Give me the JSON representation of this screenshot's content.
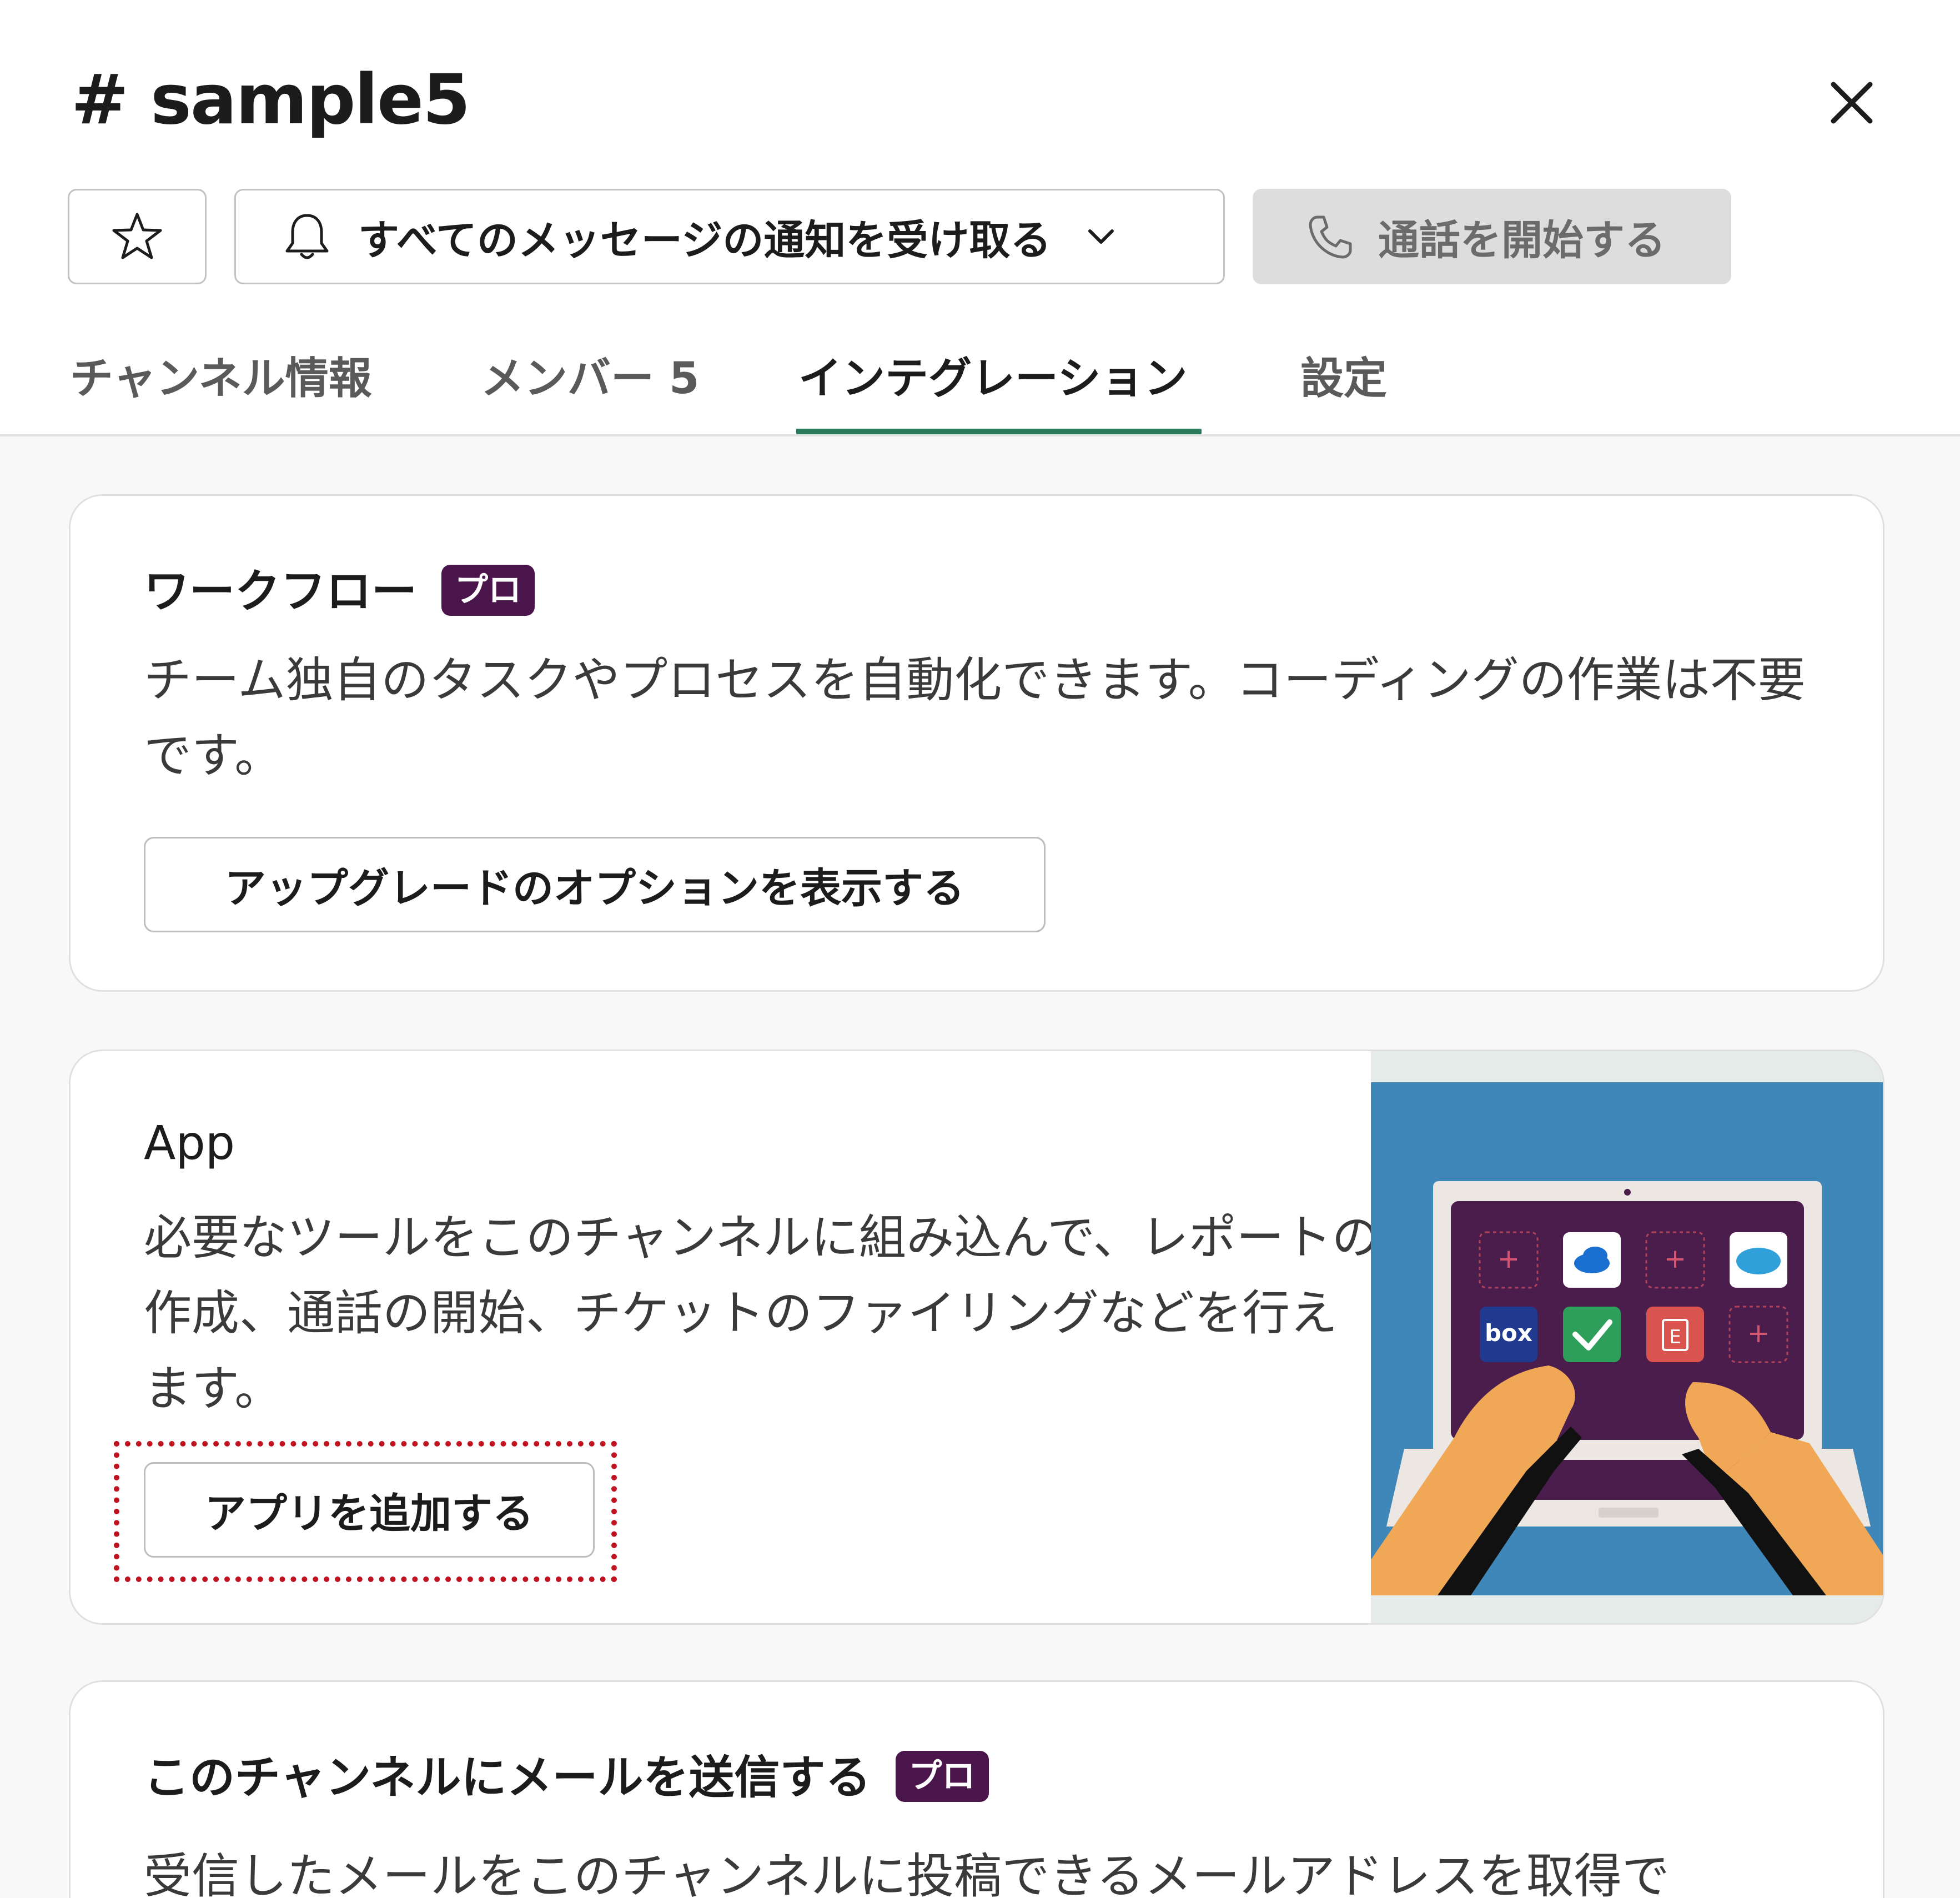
{
  "header": {
    "title": "# sample5",
    "notification_label": "すべてのメッセージの通知を受け取る",
    "call_label": "通話を開始する"
  },
  "tabs": [
    {
      "label": "チャンネル情報"
    },
    {
      "label": "メンバー 5"
    },
    {
      "label": "インテグレーション",
      "active": true
    },
    {
      "label": "設定"
    }
  ],
  "cards": {
    "workflow": {
      "title": "ワークフロー",
      "badge": "プロ",
      "description": "チーム独自のタスクやプロセスを自動化できます。コーディングの作業は不要です。",
      "button": "アップグレードのオプションを表示する"
    },
    "app": {
      "title": "App",
      "description": "必要なツールをこのチャンネルに組み込んで、レポートの作成、通話の開始、チケットのファイリングなどを行えます。",
      "button": "アプリを追加する",
      "illustration_tiles": [
        "box",
        "E"
      ]
    },
    "email": {
      "title": "このチャンネルにメールを送信する",
      "badge": "プロ",
      "description": "受信したメールをこのチャンネルに投稿できるメールアドレスを取得で"
    }
  },
  "colors": {
    "accent_tab_underline": "#2b7a5b",
    "badge_bg": "#4a154b",
    "highlight": "#c1121f",
    "illustration_bg": "#3f87b9",
    "laptop_screen": "#4b1d4d"
  }
}
